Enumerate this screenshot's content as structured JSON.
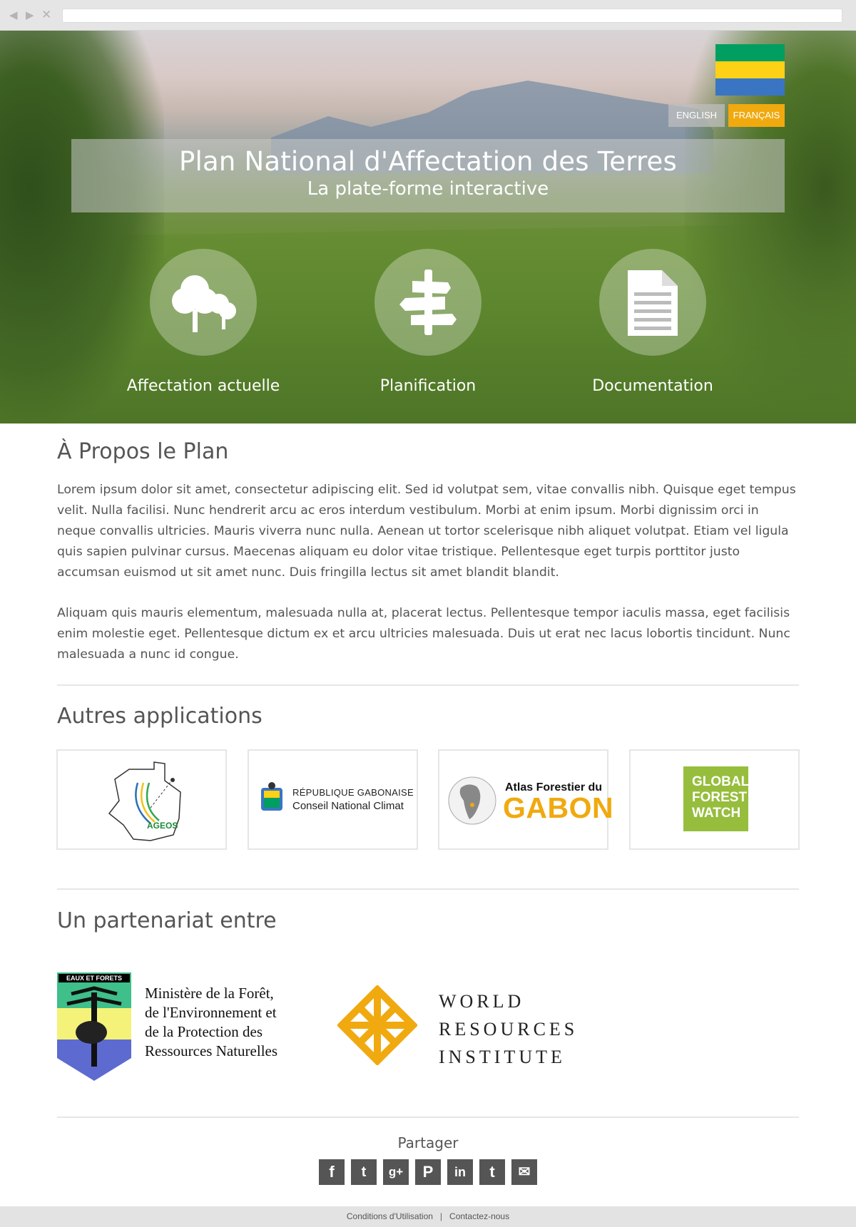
{
  "hero": {
    "title": "Plan National d'Affectation des Terres",
    "subtitle": "La plate-forme interactive",
    "languages": [
      "ENGLISH",
      "FRANÇAIS"
    ],
    "active_language": "FRANÇAIS",
    "flag_colors": [
      "#009e60",
      "#fcd116",
      "#3a75c4"
    ],
    "accent_color": "#f0a90f",
    "features": [
      {
        "label": "Affectation actuelle",
        "icon": "trees-icon"
      },
      {
        "label": "Planification",
        "icon": "signpost-icon"
      },
      {
        "label": "Documentation",
        "icon": "document-icon"
      }
    ]
  },
  "about": {
    "title": "À Propos le Plan",
    "paragraphs": [
      "Lorem ipsum dolor sit amet, consectetur adipiscing elit. Sed id volutpat sem, vitae convallis nibh. Quisque eget tempus velit. Nulla facilisi. Nunc hendrerit arcu ac eros interdum vestibulum. Morbi at enim ipsum. Morbi dignissim orci in neque convallis ultricies. Mauris viverra nunc nulla. Aenean ut tortor scelerisque nibh aliquet volutpat. Etiam vel ligula quis sapien pulvinar cursus. Maecenas aliquam eu dolor vitae tristique. Pellentesque eget turpis porttitor justo accumsan euismod ut sit amet nunc. Duis fringilla lectus sit amet blandit blandit.",
      "Aliquam quis mauris elementum, malesuada nulla at, placerat lectus. Pellentesque tempor iaculis massa, eget facilisis enim molestie eget. Pellentesque dictum ex et arcu ultricies malesuada. Duis ut erat nec lacus lobortis tincidunt. Nunc malesuada a nunc id congue."
    ]
  },
  "apps": {
    "title": "Autres applications",
    "items": [
      {
        "logo_text": "AGEOS"
      },
      {
        "line1": "RÉPUBLIQUE GABONAISE",
        "line2": "Conseil National Climat"
      },
      {
        "line1": "Atlas Forestier du",
        "line2": "GABON"
      },
      {
        "line1": "GLOBAL",
        "line2": "FOREST",
        "line3": "WATCH"
      }
    ]
  },
  "partners": {
    "title": "Un partenariat entre",
    "ministry_badge": "EAUX ET FORETS",
    "ministry_lines": [
      "Ministère de la Forêt,",
      "de l'Environnement et",
      "de la Protection des",
      "Ressources Naturelles"
    ],
    "wri_lines": [
      "WORLD",
      "RESOURCES",
      "INSTITUTE"
    ]
  },
  "share": {
    "title": "Partager",
    "networks": [
      "facebook-icon",
      "twitter-icon",
      "google-plus-icon",
      "pinterest-icon",
      "linkedin-icon",
      "tumblr-icon",
      "email-icon"
    ]
  },
  "footer": {
    "terms": "Conditions d'Utilisation",
    "separator": "|",
    "contact": "Contactez-nous"
  }
}
